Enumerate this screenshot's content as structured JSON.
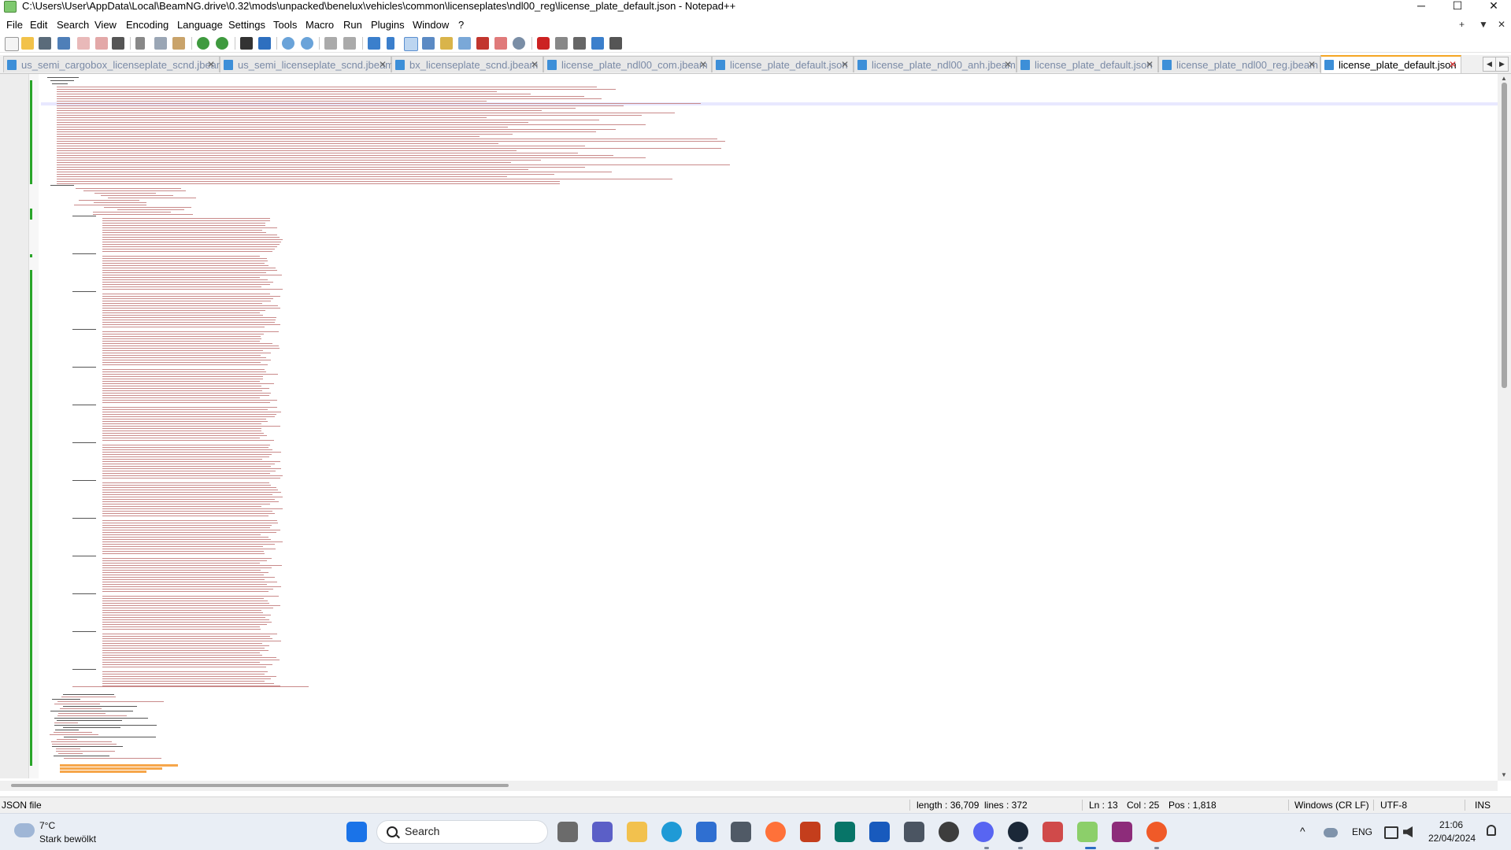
{
  "window": {
    "title": "C:\\Users\\User\\AppData\\Local\\BeamNG.drive\\0.32\\mods\\unpacked\\benelux\\vehicles\\common\\licenseplates\\ndl00_reg\\license_plate_default.json - Notepad++",
    "controls": {
      "minimize": "─",
      "maximize": "☐",
      "close": "✕"
    }
  },
  "menu": {
    "items": [
      "File",
      "Edit",
      "Search",
      "View",
      "Encoding",
      "Language",
      "Settings",
      "Tools",
      "Macro",
      "Run",
      "Plugins",
      "Window",
      "?"
    ],
    "right_glyphs": [
      "+",
      "▼",
      "✕"
    ]
  },
  "toolbar": {
    "icons": [
      "new-file-icon",
      "open-file-icon",
      "save-icon",
      "save-all-icon",
      "close-icon",
      "close-all-icon",
      "print-icon",
      "cut-icon",
      "copy-icon",
      "paste-icon",
      "undo-icon",
      "redo-icon",
      "find-icon",
      "replace-icon",
      "zoom-in-icon",
      "zoom-out-icon",
      "sync-vertical-icon",
      "sync-horizontal-icon",
      "word-wrap-icon",
      "show-all-chars-icon",
      "indent-guide-icon",
      "language-icon",
      "doc-map-icon",
      "function-list-icon",
      "folder-workspace-icon",
      "doc-switcher-icon",
      "monitor-icon",
      "record-macro-icon",
      "stop-record-icon",
      "play-macro-icon",
      "run-macro-multiple-icon",
      "save-macro-icon"
    ],
    "colors": {
      "accent": "#3d8fd8",
      "record": "#cc2222"
    }
  },
  "tabs": [
    {
      "label": "us_semi_cargobox_licenseplate_scnd.jbeam",
      "active": false
    },
    {
      "label": "us_semi_licenseplate_scnd.jbeam",
      "active": false
    },
    {
      "label": "bx_licenseplate_scnd.jbeam",
      "active": false
    },
    {
      "label": "license_plate_ndl00_com.jbeam",
      "active": false
    },
    {
      "label": "license_plate_default.json",
      "active": false
    },
    {
      "label": "license_plate_ndl00_anh.jbeam",
      "active": false
    },
    {
      "label": "license_plate_default.json",
      "active": false
    },
    {
      "label": "license_plate_ndl00_reg.jbeam",
      "active": false
    },
    {
      "label": "license_plate_default.json",
      "active": true
    }
  ],
  "tab_close_glyph": "✕",
  "tab_nav": {
    "left": "◀",
    "right": "▶"
  },
  "status": {
    "file_type": "JSON file",
    "length": "length : 36,709",
    "lines": "lines : 372",
    "ln": "Ln : 13",
    "col": "Col : 25",
    "pos": "Pos : 1,818",
    "eol": "Windows (CR LF)",
    "encoding": "UTF-8",
    "mode": "INS"
  },
  "taskbar": {
    "weather": {
      "temp": "7°C",
      "desc": "Stark bewölkt"
    },
    "search_label": "Search",
    "apps": [
      "windows-start-icon",
      "task-view-icon",
      "teams-icon",
      "file-explorer-icon",
      "edge-icon",
      "store-icon",
      "calculator-icon",
      "firefox-icon",
      "powerpoint-icon",
      "publisher-icon",
      "word-icon",
      "beamng-icon",
      "chatgpt-icon",
      "discord-icon",
      "steam-icon",
      "unknown-app-icon",
      "notepadpp-icon",
      "winrar-icon",
      "beamng-drive-icon"
    ],
    "tray": {
      "chevron": "^",
      "language": "ENG",
      "time": "21:06",
      "date": "22/04/2024"
    }
  }
}
